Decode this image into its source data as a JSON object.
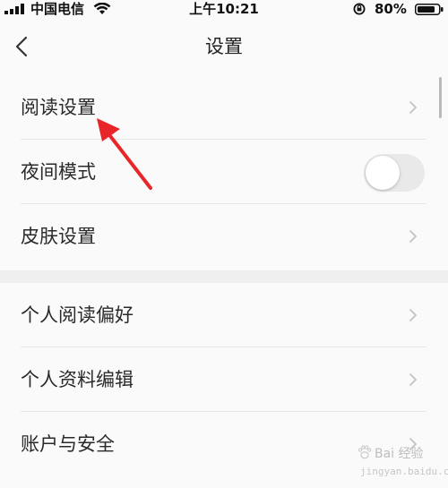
{
  "status_bar": {
    "carrier": "中国电信",
    "time": "上午10:21",
    "battery_percent": "80%",
    "icons": [
      "signal-icon",
      "wifi-icon",
      "orientation-lock-icon",
      "battery-icon"
    ]
  },
  "nav": {
    "title": "设置",
    "back_icon": "chevron-left-icon"
  },
  "settings": {
    "group1": [
      {
        "label": "阅读设置",
        "control": "chevron"
      },
      {
        "label": "夜间模式",
        "control": "toggle",
        "toggle_on": false
      },
      {
        "label": "皮肤设置",
        "control": "chevron"
      }
    ],
    "group2": [
      {
        "label": "个人阅读偏好",
        "control": "chevron"
      },
      {
        "label": "个人资料编辑",
        "control": "chevron"
      },
      {
        "label": "账户与安全",
        "control": "chevron"
      }
    ]
  },
  "watermark": {
    "text": "Bai 经验",
    "sub": "jingyan.baidu.com"
  },
  "colors": {
    "background": "#fafafa",
    "divider": "#e8e8e8",
    "group_gap": "#efefef",
    "annotation_arrow": "#e8262a"
  }
}
